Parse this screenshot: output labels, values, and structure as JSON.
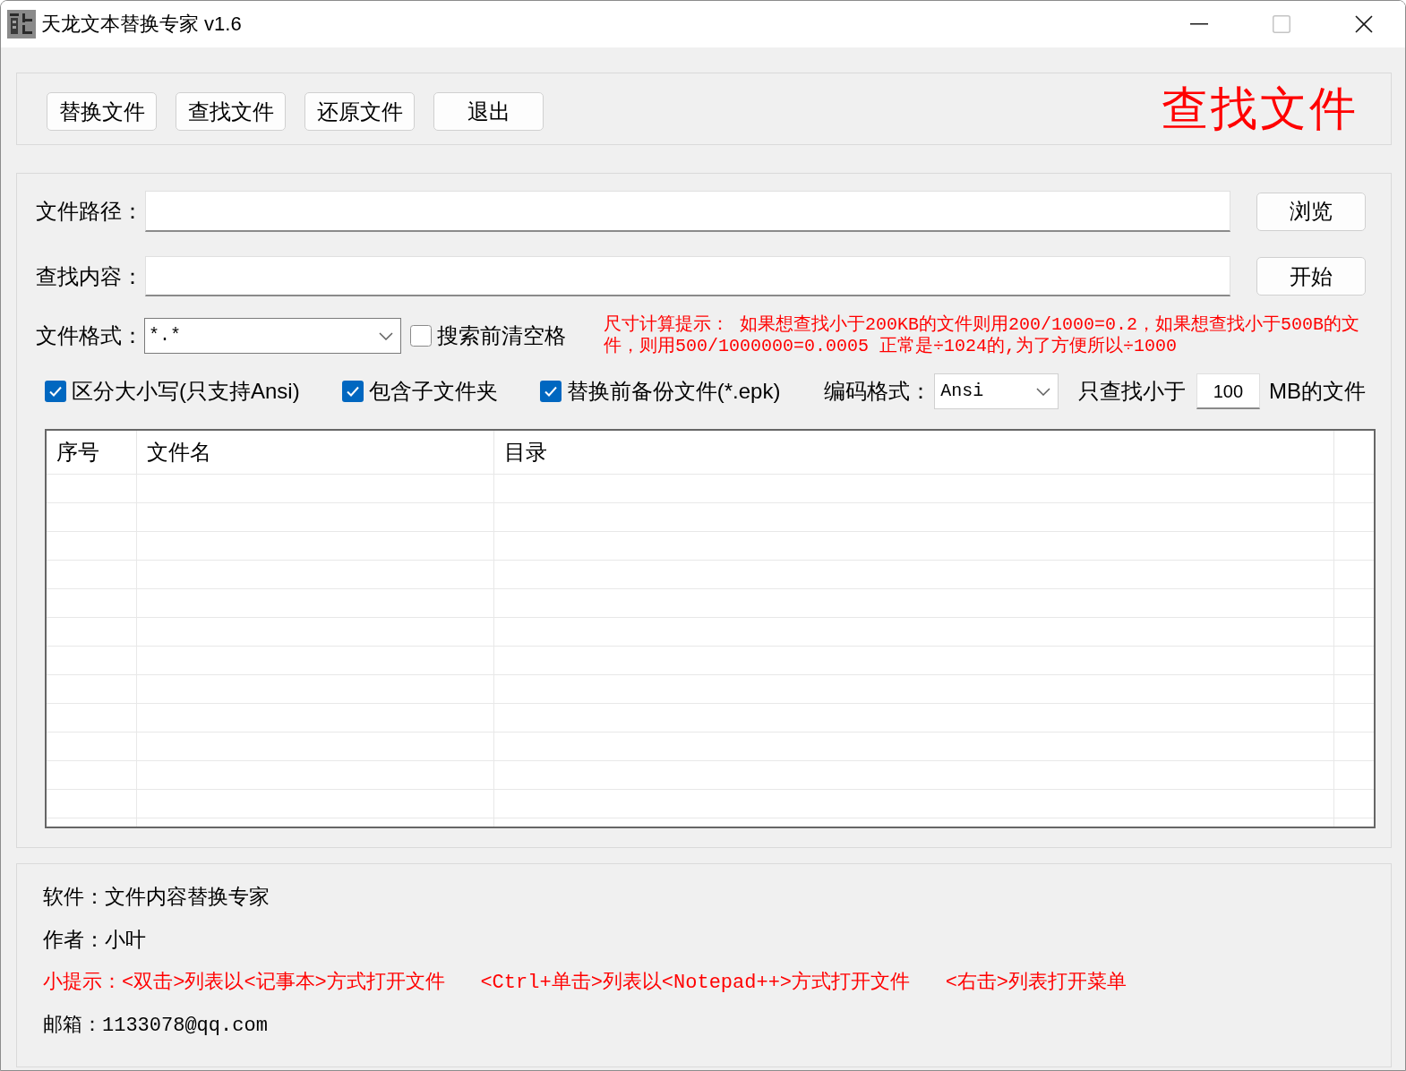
{
  "window": {
    "title": "天龙文本替换专家 v1.6",
    "maximize_disabled": true
  },
  "toolbar": {
    "buttons": [
      "替换文件",
      "查找文件",
      "还原文件",
      "退出"
    ],
    "mode_title": "查找文件"
  },
  "form": {
    "path": {
      "label": "文件路径：",
      "button": "浏览"
    },
    "search": {
      "label": "查找内容：",
      "button": "开始"
    },
    "format": {
      "label": "文件格式：",
      "value": "*.*"
    },
    "trim_option": {
      "label": "搜索前清空格",
      "checked": false
    },
    "size_hint": "尺寸计算提示： 如果想查找小于200KB的文件则用200/1000=0.2，如果想查找小于500B的文件，则用500/1000000=0.0005 正常是÷1024的,为了方便所以÷1000",
    "options": [
      {
        "label": "区分大小写(只支持Ansi)",
        "checked": true
      },
      {
        "label": "包含子文件夹",
        "checked": true
      },
      {
        "label": "替换前备份文件(*.epk)",
        "checked": true
      }
    ],
    "encoding": {
      "label": "编码格式：",
      "value": "Ansi"
    },
    "size_limit": {
      "label": "只查找小于",
      "value": "100",
      "unit": "MB的文件"
    }
  },
  "table": {
    "columns": [
      "序号",
      "文件名",
      "目录"
    ]
  },
  "footer": {
    "lines": [
      {
        "kind": "info",
        "text": "软件：文件内容替换专家"
      },
      {
        "kind": "info",
        "text": "作者：小叶"
      },
      {
        "kind": "tip",
        "text": "小提示：<双击>列表以<记事本>方式打开文件   <Ctrl+单击>列表以<Notepad++>方式打开文件   <右击>列表打开菜单"
      },
      {
        "kind": "contact",
        "text": "邮箱：1133078@qq.com"
      }
    ]
  }
}
